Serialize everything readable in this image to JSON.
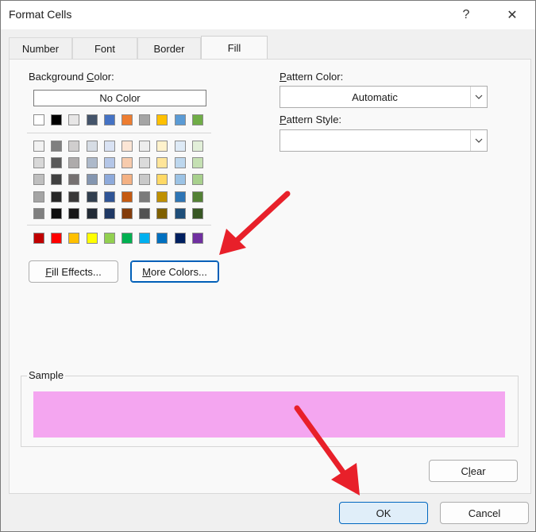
{
  "window": {
    "title": "Format Cells",
    "help_glyph": "?",
    "close_glyph": "✕"
  },
  "tabs": [
    {
      "label": "Number",
      "active": false
    },
    {
      "label": "Font",
      "active": false
    },
    {
      "label": "Border",
      "active": false
    },
    {
      "label": "Fill",
      "active": true
    }
  ],
  "fill": {
    "background_color": {
      "label_pre": "Background ",
      "label_key": "C",
      "label_post": "olor:"
    },
    "no_color_label": "No Color",
    "palette": {
      "top_row": [
        "#ffffff",
        "#000000",
        "#e7e6e6",
        "#44546a",
        "#4472c4",
        "#ed7d31",
        "#a5a5a5",
        "#ffc000",
        "#5b9bd5",
        "#70ad47"
      ],
      "tint_rows": [
        [
          "#f2f2f2",
          "#7f7f7f",
          "#d0cece",
          "#d6dce4",
          "#d9e2f3",
          "#fbe5d5",
          "#ededed",
          "#fff2cc",
          "#deeaf6",
          "#e2efd9"
        ],
        [
          "#d8d8d8",
          "#595959",
          "#aeabab",
          "#adb9ca",
          "#b4c6e7",
          "#f7cbac",
          "#dbdbdb",
          "#ffe599",
          "#bdd7ee",
          "#c5e0b3"
        ],
        [
          "#bfbfbf",
          "#3f3f3f",
          "#757070",
          "#8496b0",
          "#8eaadb",
          "#f4b183",
          "#c9c9c9",
          "#ffd965",
          "#9cc3e5",
          "#a8d08d"
        ],
        [
          "#a5a5a5",
          "#262626",
          "#3a3838",
          "#323f4f",
          "#2f5496",
          "#c55a11",
          "#7b7b7b",
          "#bf9000",
          "#2e75b5",
          "#538135"
        ],
        [
          "#7f7f7f",
          "#0c0c0c",
          "#171616",
          "#222a35",
          "#1f3864",
          "#833c0b",
          "#525252",
          "#7f6000",
          "#1e4e79",
          "#375623"
        ]
      ],
      "standard_row": [
        "#c00000",
        "#ff0000",
        "#ffc000",
        "#ffff00",
        "#92d050",
        "#00b050",
        "#00b0f0",
        "#0070c0",
        "#002060",
        "#7030a0"
      ]
    },
    "fill_effects": {
      "pre": "",
      "key": "F",
      "post": "ill Effects..."
    },
    "more_colors": {
      "pre": "",
      "key": "M",
      "post": "ore Colors..."
    },
    "pattern_color": {
      "label_key": "P",
      "label_post": "attern Color:",
      "value": "Automatic"
    },
    "pattern_style": {
      "label_key": "P",
      "label_post": "attern Style:",
      "value": ""
    },
    "sample": {
      "label": "Sample",
      "color": "#f4a6f0"
    },
    "clear": {
      "pre": "C",
      "key": "l",
      "post": "ear"
    }
  },
  "footer": {
    "ok_label": "OK",
    "cancel_label": "Cancel"
  },
  "annotation": {
    "arrow_color": "#e8202a"
  }
}
